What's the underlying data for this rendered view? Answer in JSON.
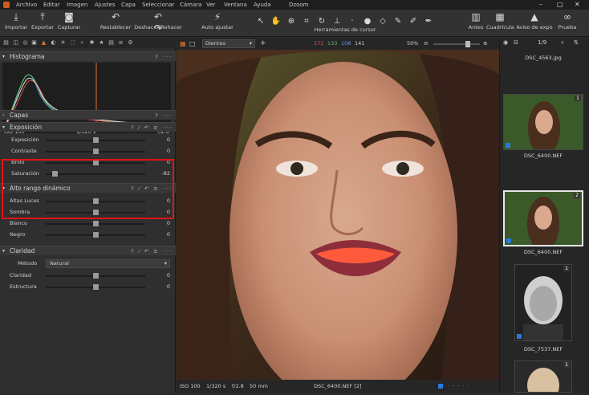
{
  "menu": {
    "items": [
      "Archivo",
      "Editar",
      "Imagen",
      "Ajustes",
      "Capa",
      "Seleccionar",
      "Cámara",
      "Ver",
      "Ventana",
      "Ayuda"
    ],
    "title": "Dzoom",
    "window_controls": [
      "–",
      "□",
      "✕"
    ]
  },
  "toolbar": {
    "importar": "Importar",
    "exportar": "Exportar",
    "capturar": "Capturar",
    "restablecer": "Restablecer",
    "deshacer": "Deshacer/Rehacer",
    "auto": "Auto ajustar",
    "cursor_tools": "Herramientas de cursor",
    "antes": "Antes",
    "cuadricula": "Cuadrícula",
    "aviso": "Aviso de expo",
    "prueba": "Prueba"
  },
  "histogram": {
    "title": "Histograma",
    "iso": "ISO 100",
    "shutter": "1/320 s",
    "aperture": "f/2.8"
  },
  "capas": {
    "title": "Capas"
  },
  "exposicion": {
    "title": "Exposición",
    "sliders": [
      {
        "label": "Exposición",
        "value": "0",
        "pos": 0.5
      },
      {
        "label": "Contraste",
        "value": "0",
        "pos": 0.5
      },
      {
        "label": "Brillo",
        "value": "0",
        "pos": 0.5
      },
      {
        "label": "Saturación",
        "value": "-82",
        "pos": 0.09
      }
    ]
  },
  "hdr": {
    "title": "Alto rango dinámico",
    "sliders": [
      {
        "label": "Altas Luces",
        "value": "0",
        "pos": 0.5
      },
      {
        "label": "Sombra",
        "value": "0",
        "pos": 0.5
      },
      {
        "label": "Blanco",
        "value": "0",
        "pos": 0.5
      },
      {
        "label": "Negro",
        "value": "0",
        "pos": 0.5
      }
    ]
  },
  "claridad": {
    "title": "Claridad",
    "method_label": "Método",
    "method_value": "Natural",
    "sliders": [
      {
        "label": "Claridad",
        "value": "0",
        "pos": 0.5
      },
      {
        "label": "Estructura",
        "value": "0",
        "pos": 0.5
      }
    ]
  },
  "viewer": {
    "layer_select": "Dientes",
    "rgb_r": "172",
    "rgb_g": "133",
    "rgb_b": "108",
    "rgb_l": "141",
    "zoom": "50%"
  },
  "status": {
    "iso": "ISO 100",
    "shutter": "1/320 s",
    "aperture": "f/2.8",
    "focal": "50 mm",
    "filename": "DSC_6400.NEF [2]"
  },
  "browser": {
    "counter": "1/9",
    "top_file": "DSC_4563.jpg",
    "thumbs": [
      {
        "name": "DSC_6400.NEF",
        "num": "1"
      },
      {
        "name": "DSC_6400.NEF",
        "num": "2"
      },
      {
        "name": "DSC_7537.NEF",
        "num": "1"
      },
      {
        "name": "",
        "num": "1"
      }
    ]
  },
  "colors": {
    "accent": "#e0752a",
    "highlight_frame": "#e01414",
    "teeth_mask": "#ff5a3c"
  }
}
